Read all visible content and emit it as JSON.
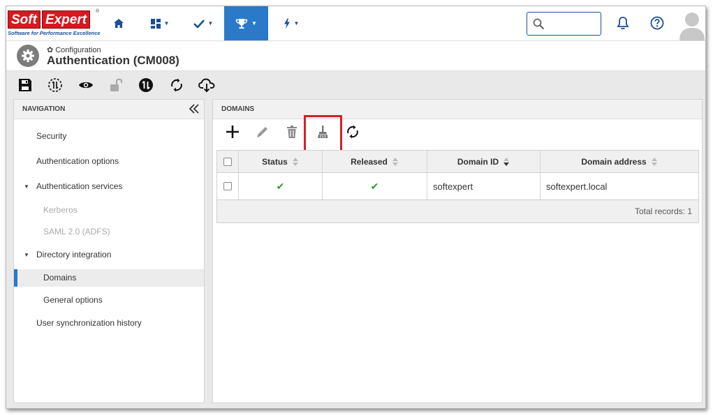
{
  "brand": {
    "logo_word1": "Soft",
    "logo_word2": "Expert",
    "logo_reg": "®",
    "tagline": "Software for Performance Excellence",
    "red": "#d71920",
    "blue": "#1a4e96"
  },
  "topnav": {
    "items": [
      {
        "icon": "home-icon"
      },
      {
        "icon": "dashboard-icon"
      },
      {
        "icon": "checkmark-icon"
      },
      {
        "icon": "trophy-icon",
        "active": true
      },
      {
        "icon": "lightning-icon"
      }
    ],
    "active_color": "#2a7ac8",
    "search_placeholder": "",
    "right_icons": [
      "bell-icon",
      "help-icon",
      "user-avatar"
    ]
  },
  "header": {
    "breadcrumb": "Configuration",
    "title": "Authentication (CM008)"
  },
  "toolbar": {
    "icons": [
      "save-icon",
      "revision-icon",
      "view-icon",
      "unlock-icon",
      "workflow-icon",
      "sync-icon",
      "cloud-download-icon"
    ]
  },
  "navigation": {
    "title": "NAVIGATION",
    "items": [
      {
        "label": "Security"
      },
      {
        "label": "Authentication options"
      },
      {
        "label": "Authentication services"
      },
      {
        "label": "Kerberos"
      },
      {
        "label": "SAML 2.0 (ADFS)"
      },
      {
        "label": "Directory integration"
      },
      {
        "label": "Domains"
      },
      {
        "label": "General options"
      },
      {
        "label": "User synchronization history"
      }
    ]
  },
  "domains": {
    "title": "DOMAINS",
    "toolbar_icons": [
      "add-icon",
      "edit-icon",
      "delete-icon",
      "clean-icon",
      "refresh-icon"
    ],
    "columns": [
      "Status",
      "Released",
      "Domain ID",
      "Domain address"
    ],
    "rows": [
      {
        "status": "✔",
        "released": "✔",
        "domain_id": "softexpert",
        "domain_address": "softexpert.local"
      }
    ],
    "total": "Total records: 1"
  }
}
